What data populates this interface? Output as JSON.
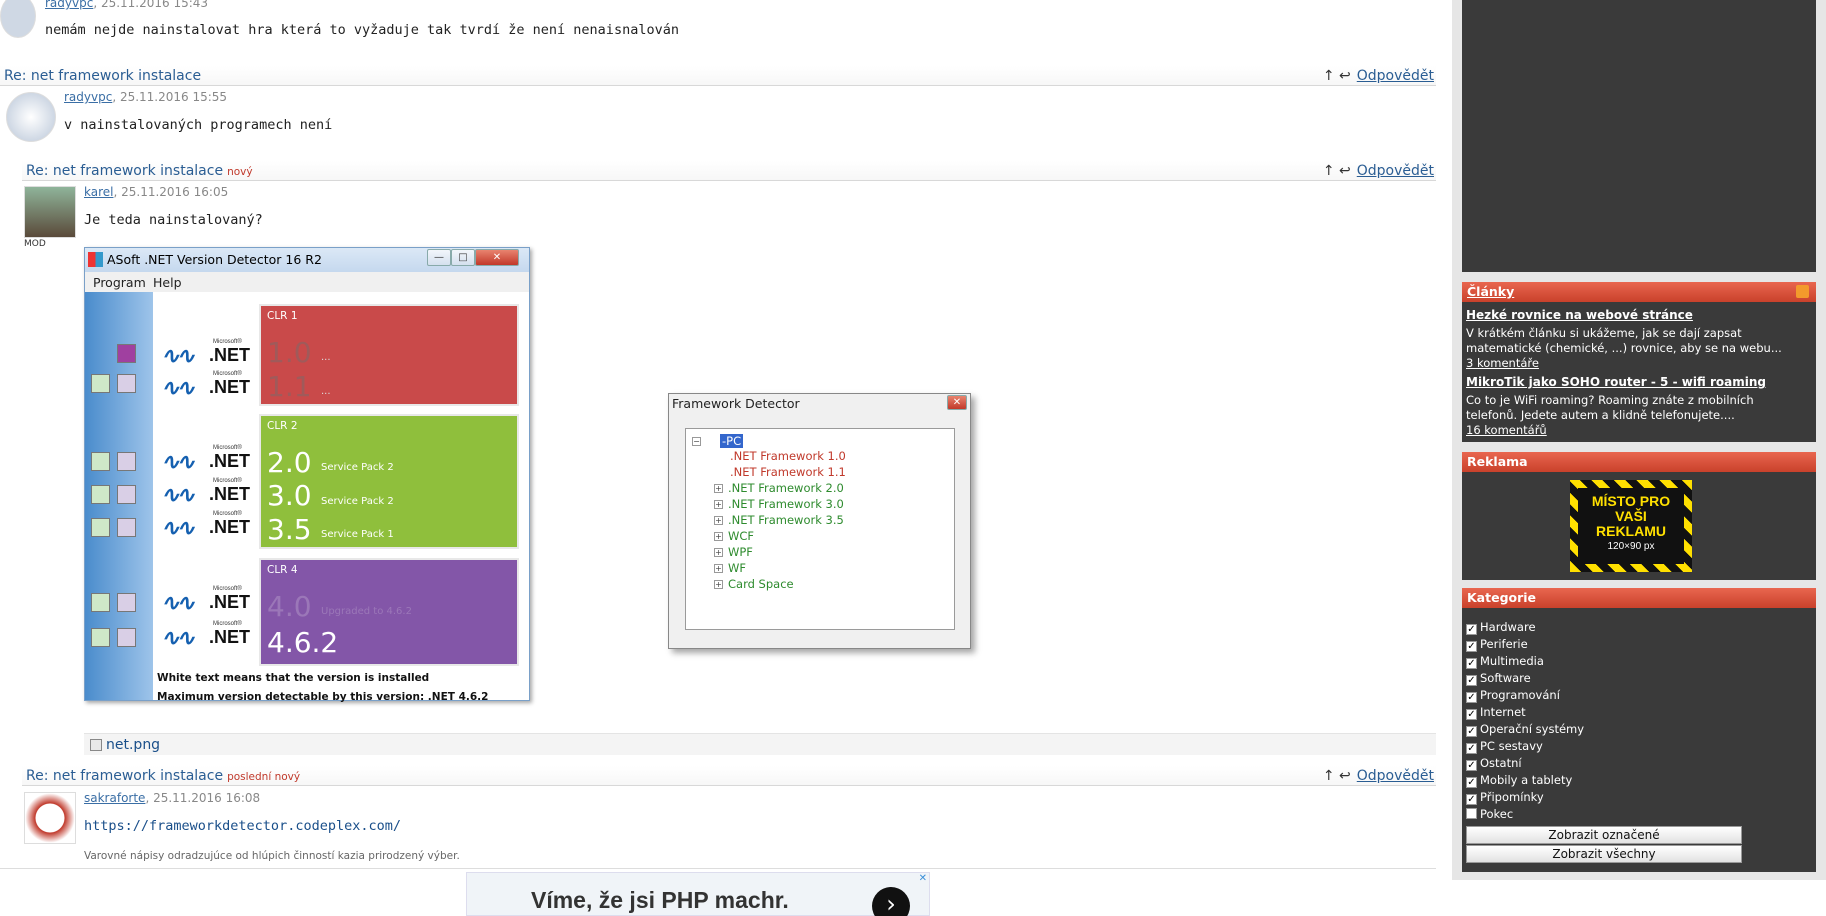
{
  "posts": [
    {
      "author": "radyvpc",
      "date": ", 25.11.2016 15:43",
      "text": "nemám nejde nainstalovat hra která to vyžaduje tak tvrdí že není nenaisnalován"
    },
    {
      "title": "Re: net framework instalace",
      "reply": "Odpovědět",
      "author": "radyvpc",
      "date": ", 25.11.2016 15:55",
      "text": "v nainstalovaných programech není"
    },
    {
      "title": "Re: net framework instalace",
      "badge": "nový",
      "reply": "Odpovědět",
      "author": "karel",
      "date": ", 25.11.2016 16:05",
      "text": "Je teda nainstalovaný?",
      "mod": "MOD"
    },
    {
      "title": "Re: net framework instalace",
      "badge": "poslední nový",
      "reply": "Odpovědět",
      "author": "sakraforte",
      "date": ", 25.11.2016 16:08",
      "link": "https://frameworkdetector.codeplex.com/",
      "signature": "Varovné nápisy odradzujúce od hlúpich činností kazia prirodzený výber."
    }
  ],
  "attachment": "net.png",
  "arrows": "↑ ↩",
  "netdetector": {
    "title": "ASoft .NET Version Detector 16 R2",
    "menu": [
      "Program",
      "Help"
    ],
    "wave": "∿∿",
    "microsoft": "Microsoft®",
    "net": ".NET",
    "clr1": {
      "label": "CLR 1",
      "v1": "1.0",
      "v2": "1.1",
      "dots": "..."
    },
    "clr2": {
      "label": "CLR 2",
      "v1": "2.0",
      "v2": "3.0",
      "v3": "3.5",
      "sp1": "Service Pack 2",
      "sp2": "Service Pack 2",
      "sp3": "Service Pack 1"
    },
    "clr4": {
      "label": "CLR 4",
      "v1": "4.0",
      "v1note": "Upgraded to 4.6.2",
      "v2": "4.6.2"
    },
    "footer1": "White text means that the version is installed",
    "footer2": "Maximum version detectable by this version: .NET 4.6.2",
    "btn_min": "—",
    "btn_max": "□",
    "btn_close": "✕"
  },
  "fwdetector": {
    "title": "Framework Detector",
    "root": "-PC",
    "items": [
      ".NET Framework 1.0",
      ".NET Framework 1.1",
      ".NET Framework 2.0",
      ".NET Framework 3.0",
      ".NET Framework 3.5",
      "WCF",
      "WPF",
      "WF",
      "Card Space"
    ],
    "close": "✕",
    "minus": "−",
    "plus": "+"
  },
  "ad": {
    "text": "Víme, že jsi PHP machr.",
    "arrow": "›",
    "x": "✕"
  },
  "sidebar": {
    "clanky": "Články",
    "articles": [
      {
        "title": "Hezké rovnice na webové stránce",
        "desc": "V krátkém článku si ukážeme, jak se dají zapsat matematické (chemické, ...) rovnice, aby se na webu...",
        "comments": "3 komentáře"
      },
      {
        "title": "MikroTik jako SOHO router - 5 - wifi roaming",
        "desc": "Co to je WiFi roaming? Roaming znáte z mobilních telefonů. Jedete autem a klidně telefonujete....",
        "comments": "16 komentářů"
      }
    ],
    "reklama": "Reklama",
    "adbox": {
      "l1": "MÍSTO PRO",
      "l2": "VAŠI",
      "l3": "REKLAMU",
      "l4": "120×90 px"
    },
    "kategorie": "Kategorie",
    "categories": [
      {
        "name": "Hardware",
        "checked": true
      },
      {
        "name": "Periferie",
        "checked": true
      },
      {
        "name": "Multimedia",
        "checked": true
      },
      {
        "name": "Software",
        "checked": true
      },
      {
        "name": "Programování",
        "checked": true
      },
      {
        "name": "Internet",
        "checked": true
      },
      {
        "name": "Operační systémy",
        "checked": true
      },
      {
        "name": "PC sestavy",
        "checked": true
      },
      {
        "name": "Ostatní",
        "checked": true
      },
      {
        "name": "Mobily a tablety",
        "checked": true
      },
      {
        "name": "Připomínky",
        "checked": true
      },
      {
        "name": "Pokec",
        "checked": false
      }
    ],
    "check": "✓",
    "btn_marked": "Zobrazit označené",
    "btn_all": "Zobrazit všechny"
  }
}
